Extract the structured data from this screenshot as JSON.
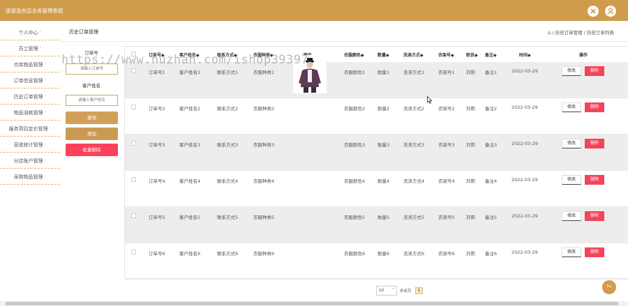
{
  "app": {
    "title": "连锁洗衣店业务管理系统"
  },
  "topbar": {
    "icons": [
      "expand-icon",
      "user-icon"
    ]
  },
  "sidebar": {
    "items": [
      {
        "label": "个人中心"
      },
      {
        "label": "员工管理"
      },
      {
        "label": "仓库物品管理"
      },
      {
        "label": "订单信息管理"
      },
      {
        "label": "历史订单管理"
      },
      {
        "label": "物品消耗管理"
      },
      {
        "label": "服务项目定价管理"
      },
      {
        "label": "营收统计管理"
      },
      {
        "label": "分店账户管理"
      },
      {
        "label": "采购物品管理"
      }
    ],
    "chevron": "˅"
  },
  "header": {
    "page_title": "历史订单管理",
    "breadcrumb": "/ 历史订单管理 / 历史订单列表"
  },
  "search": {
    "order_label": "订单号",
    "order_placeholder": "请输入订单号",
    "customer_label": "客户姓名",
    "customer_placeholder": "请输入客户姓名",
    "query_label": "查询",
    "add_label": "添加",
    "batch_delete_label": "批量删除"
  },
  "table": {
    "columns": [
      "订单号◆",
      "客户姓名◆",
      "联系方式◆",
      "衣服种类◆",
      "图片",
      "衣服颜色◆",
      "数量◆",
      "洗涤方式◆",
      "衣架号◆",
      "职员◆",
      "备注◆",
      "时间◆",
      "操作"
    ],
    "edit_label": "修改",
    "delete_label": "删除",
    "rows": [
      {
        "order": "订单号1",
        "customer": "客户姓名1",
        "contact": "联系方式1",
        "type": "衣服种类1",
        "color": "衣服颜色1",
        "qty": "数量1",
        "wash": "洗涤方式1",
        "hanger": "衣架号1",
        "staff": "刘莉",
        "note": "备注1",
        "time": "2022-03-29"
      },
      {
        "order": "订单号2",
        "customer": "客户姓名2",
        "contact": "联系方式2",
        "type": "衣服种类2",
        "color": "衣服颜色2",
        "qty": "数量2",
        "wash": "洗涤方式2",
        "hanger": "衣架号2",
        "staff": "刘莉",
        "note": "备注2",
        "time": "2022-03-29"
      },
      {
        "order": "订单号3",
        "customer": "客户姓名3",
        "contact": "联系方式3",
        "type": "衣服种类3",
        "color": "衣服颜色3",
        "qty": "数量3",
        "wash": "洗涤方式3",
        "hanger": "衣架号3",
        "staff": "刘莉",
        "note": "备注3",
        "time": "2022-03-29"
      },
      {
        "order": "订单号4",
        "customer": "客户姓名4",
        "contact": "联系方式4",
        "type": "衣服种类4",
        "color": "衣服颜色4",
        "qty": "数量4",
        "wash": "洗涤方式4",
        "hanger": "衣架号4",
        "staff": "刘莉",
        "note": "备注4",
        "time": "2022-03-29"
      },
      {
        "order": "订单号5",
        "customer": "客户姓名5",
        "contact": "联系方式5",
        "type": "衣服种类5",
        "color": "衣服颜色5",
        "qty": "数量5",
        "wash": "洗涤方式5",
        "hanger": "衣架号5",
        "staff": "刘莉",
        "note": "备注5",
        "time": "2022-03-29"
      },
      {
        "order": "订单号6",
        "customer": "客户姓名6",
        "contact": "联系方式6",
        "type": "衣服种类6",
        "color": "衣服颜色6",
        "qty": "数量6",
        "wash": "洗涤方式6",
        "hanger": "衣架号6",
        "staff": "刘莉",
        "note": "备注6",
        "time": "2022-03-29"
      }
    ]
  },
  "pagination": {
    "page_size": "10",
    "total_label": "条每页",
    "current_page": "1"
  },
  "top_button": {
    "label": "Top"
  },
  "watermark": {
    "text": "https://www.huzhan.com/ishop39397"
  },
  "colors": {
    "accent": "#cf9c4b",
    "danger": "#f5435a",
    "row_alt": "#ededed"
  }
}
